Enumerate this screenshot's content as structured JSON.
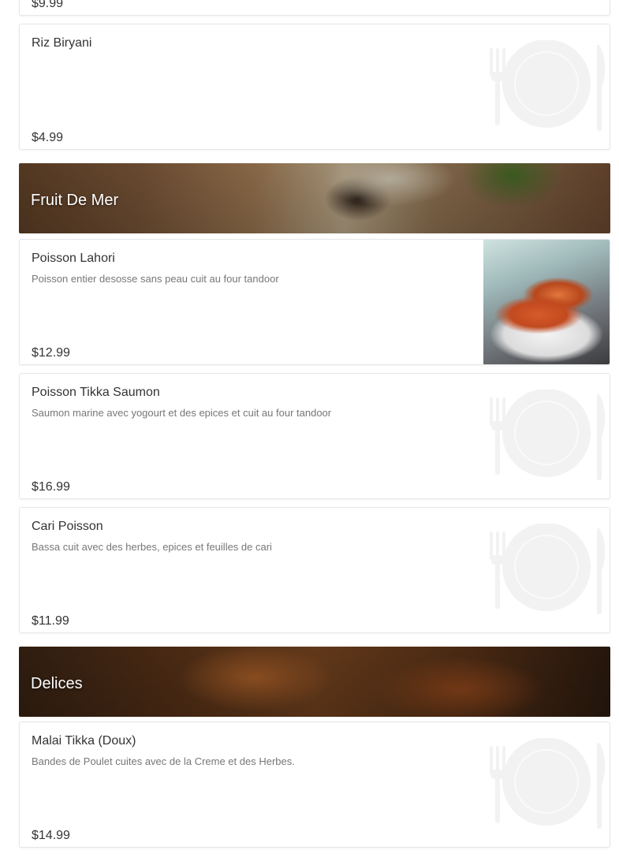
{
  "sections": [
    {
      "title": "Fruit De Mer"
    },
    {
      "title": "Delices"
    }
  ],
  "items": [
    {
      "name": "",
      "description": "",
      "price": "$9.99"
    },
    {
      "name": "Riz Biryani",
      "description": "",
      "price": "$4.99",
      "image": "placeholder"
    },
    {
      "name": "Poisson Lahori",
      "description": "Poisson entier desosse sans peau cuit au four tandoor",
      "price": "$12.99",
      "image": "photo"
    },
    {
      "name": "Poisson Tikka Saumon",
      "description": "Saumon marine avec yogourt et des epices et cuit au four tandoor",
      "price": "$16.99",
      "image": "placeholder"
    },
    {
      "name": "Cari Poisson",
      "description": "Bassa cuit avec des herbes, epices et feuilles de cari",
      "price": "$11.99",
      "image": "placeholder"
    },
    {
      "name": "Malai Tikka (Doux)",
      "description": "Bandes de Poulet cuites avec de la Creme et des Herbes.",
      "price": "$14.99",
      "image": "placeholder"
    }
  ]
}
